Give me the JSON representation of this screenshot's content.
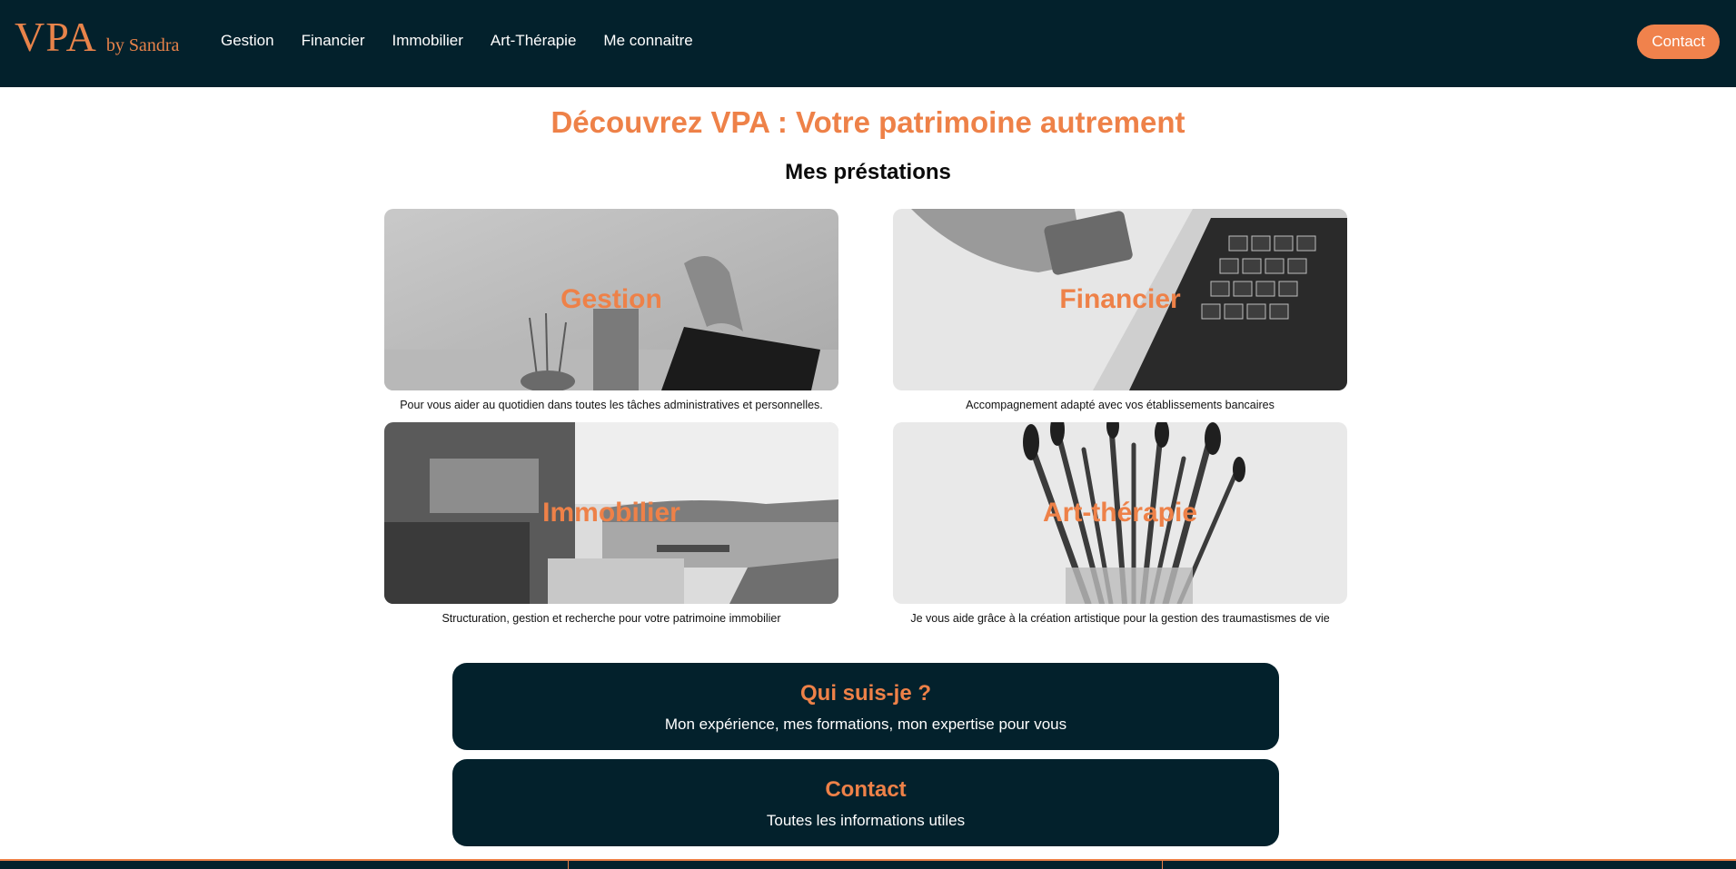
{
  "nav": {
    "logo_main": "VPA",
    "logo_sub": "by Sandra",
    "items": [
      "Gestion",
      "Financier",
      "Immobilier",
      "Art-Thérapie",
      "Me connaitre"
    ],
    "contact_label": "Contact"
  },
  "hero": {
    "title": "Découvrez VPA : Votre patrimoine autrement",
    "subtitle": "Mes préstations"
  },
  "services": [
    {
      "title": "Gestion",
      "description": "Pour vous aider au quotidien dans toutes les tâches administratives et personnelles."
    },
    {
      "title": "Financier",
      "description": "Accompagnement adapté avec vos établissements bancaires"
    },
    {
      "title": "Immobilier",
      "description": "Structuration, gestion et recherche pour votre patrimoine immobilier"
    },
    {
      "title": "Art-thérapie",
      "description": "Je vous aide grâce à la création artistique pour la gestion des traumastismes de vie"
    }
  ],
  "blocks": [
    {
      "title": "Qui suis-je ?",
      "subtitle": "Mon expérience, mes formations, mon expertise pour vous"
    },
    {
      "title": "Contact",
      "subtitle": "Toutes les informations utiles"
    }
  ],
  "colors": {
    "navy": "#03212c",
    "accent": "#ee8148",
    "white": "#ffffff"
  }
}
